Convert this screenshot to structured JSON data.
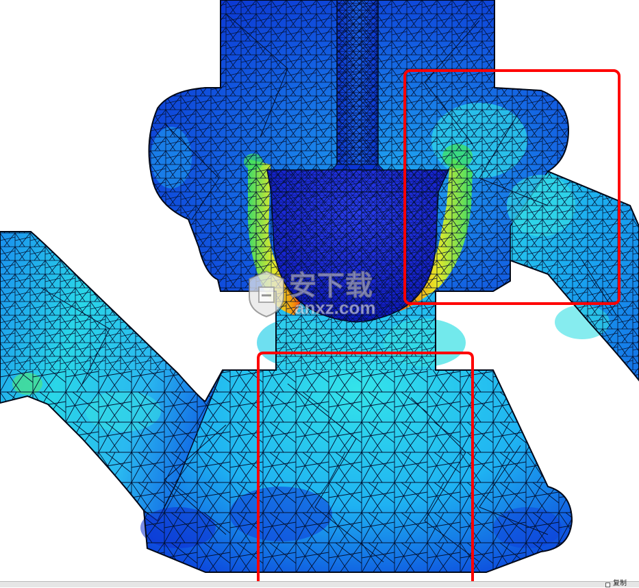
{
  "viewport": {
    "content": "fea-mesh-stress-view"
  },
  "stress_colors": {
    "low": "#0a2fd6",
    "mid_low": "#1f9ff0",
    "mid": "#2fe0e0",
    "mid_high": "#3fe060",
    "high_yellow": "#f0f020",
    "high_orange": "#ff9000",
    "high_red": "#ff2a00"
  },
  "highlight_boxes": {
    "color": "#ff0000"
  },
  "watermark": {
    "title": "安下载",
    "domain": "anxz.com"
  },
  "statusbar": {
    "copy_label": "复制"
  }
}
